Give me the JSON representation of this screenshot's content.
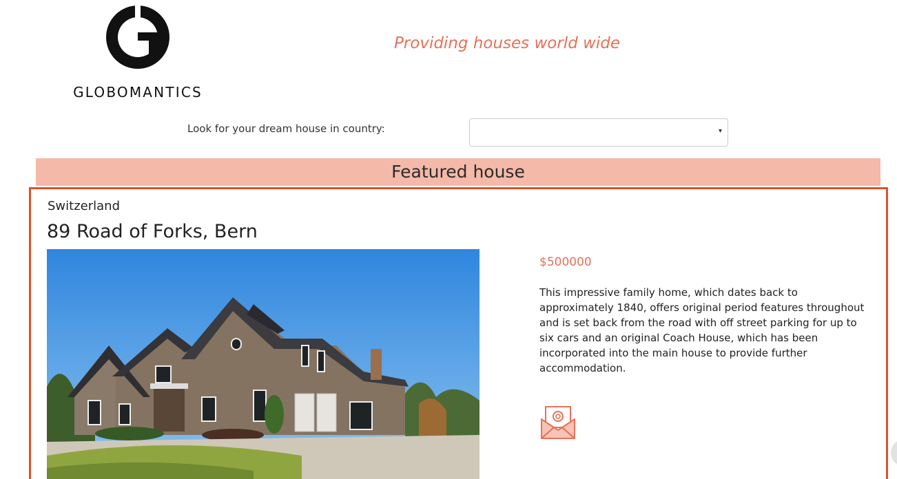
{
  "header": {
    "brand": "GLOBOMANTICS",
    "logo_letter": "G",
    "tagline": "Providing houses world wide"
  },
  "search": {
    "label": "Look for your dream house in country:",
    "selected_value": "",
    "caret": "▾"
  },
  "featured": {
    "heading": "Featured house",
    "country": "Switzerland",
    "address": "89 Road of Forks, Bern",
    "price": "$500000",
    "description": "This impressive family home, which dates back to approximately 1840, offers original period features throughout and is set back from the road with off street parking for up to six cars and an original Coach House, which has been incorporated into the main house to provide further accommodation.",
    "contact_icon": "email-envelope-icon"
  },
  "colors": {
    "accent": "#e57159",
    "featured_bar": "#f4b9a8",
    "card_border": "#d9542b"
  }
}
